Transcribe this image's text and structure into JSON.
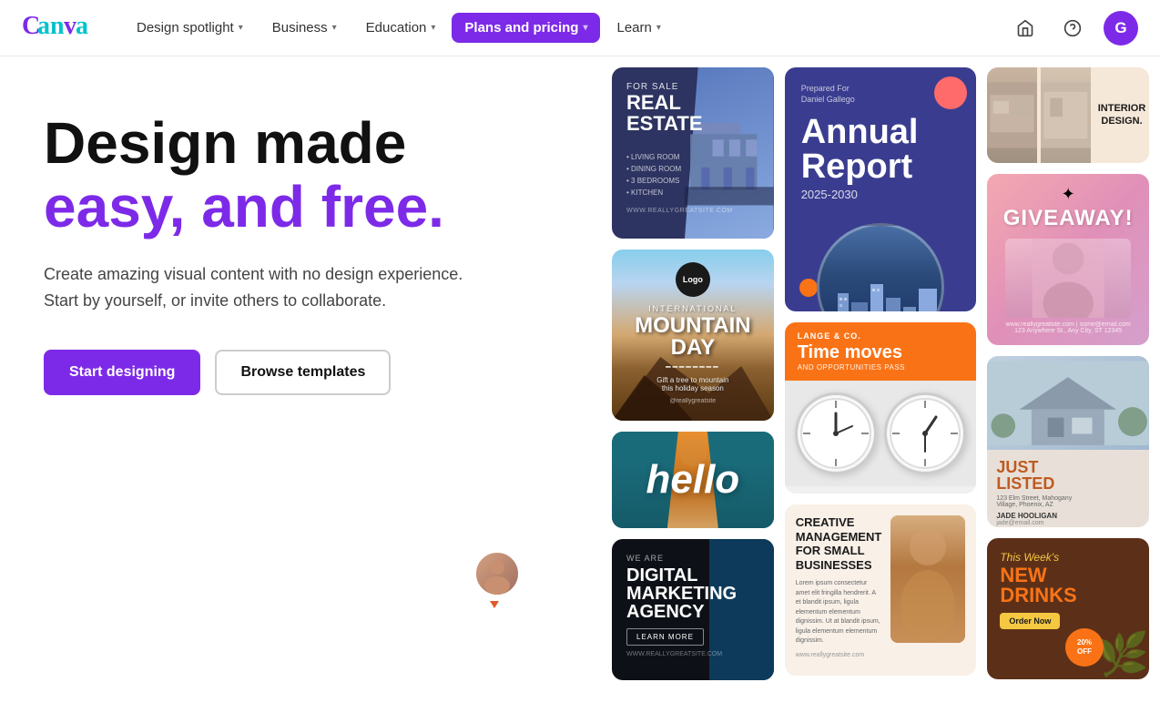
{
  "nav": {
    "logo": "Canva",
    "items": [
      {
        "label": "Design spotlight",
        "hasDropdown": true,
        "active": false
      },
      {
        "label": "Business",
        "hasDropdown": true,
        "active": false
      },
      {
        "label": "Education",
        "hasDropdown": true,
        "active": false
      },
      {
        "label": "Plans and pricing",
        "hasDropdown": true,
        "active": true
      },
      {
        "label": "Learn",
        "hasDropdown": true,
        "active": false
      }
    ],
    "avatar_initial": "G"
  },
  "hero": {
    "title_line1": "Design made",
    "title_line2": "easy, and free.",
    "subtitle": "Create amazing visual content with no design experience. Start by yourself, or invite others to collaborate.",
    "btn_primary": "Start designing",
    "btn_secondary": "Browse templates"
  },
  "templates": {
    "col1": [
      {
        "type": "real-estate",
        "title": "REAL ESTATE",
        "subtitle": "FOR SALE"
      },
      {
        "type": "mountain",
        "title": "MOUNTAIN DAY",
        "subtitle": "INTERNATIONAL"
      },
      {
        "type": "hello",
        "title": "hello"
      },
      {
        "type": "digital-agency",
        "title": "DIGITAL MARKETING AGENCY"
      }
    ],
    "col2": [
      {
        "type": "annual-report",
        "title": "Annual Report",
        "year": "2025-2030"
      },
      {
        "type": "time-moves",
        "company": "LANGE & CO.",
        "tagline": "Time moves",
        "sub": "AND OPPORTUNITIES PASS"
      },
      {
        "type": "creative-mgmt",
        "title": "CREATIVE MANAGEMENT FOR SMALL BUSINESSES"
      }
    ],
    "col3": [
      {
        "type": "interior",
        "title": "INTERIOR DESIGN."
      },
      {
        "type": "giveaway",
        "title": "GIVEAWAY!"
      },
      {
        "type": "just-listed",
        "title": "JUST LISTED"
      },
      {
        "type": "new-drinks",
        "title": "NEW DRINKS",
        "week": "This Week's"
      }
    ]
  }
}
